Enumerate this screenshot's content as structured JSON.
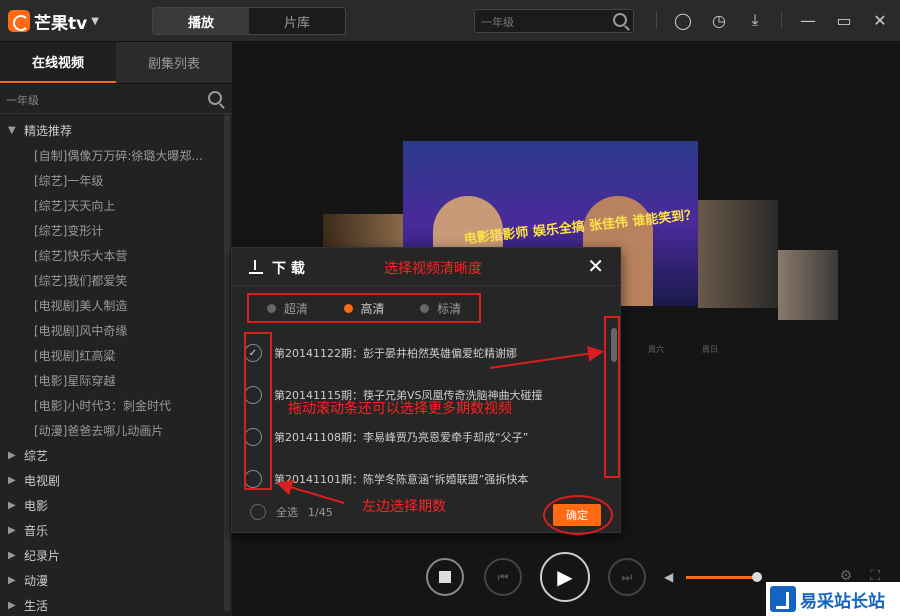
{
  "app": {
    "logo_text": "芒果tv",
    "tabs": [
      "播放",
      "片库"
    ],
    "search_placeholder": "一年级"
  },
  "sidebar": {
    "tabs": [
      "在线视频",
      "剧集列表"
    ],
    "search_placeholder": "一年级",
    "featured": {
      "label": "精选推荐",
      "items": [
        "[自制]偶像万万碎:徐璐大曝郑...",
        "[综艺]一年级",
        "[综艺]天天向上",
        "[综艺]变形计",
        "[综艺]快乐大本营",
        "[综艺]我们都爱笑",
        "[电视剧]美人制造",
        "[电视剧]风中奇缘",
        "[电视剧]红高粱",
        "[电影]星际穿越",
        "[电影]小时代3：刺金时代",
        "[动漫]爸爸去哪儿动画片"
      ]
    },
    "categories": [
      "综艺",
      "电视剧",
      "电影",
      "音乐",
      "纪录片",
      "动漫",
      "生活"
    ]
  },
  "poster": {
    "caption": "电影猎影师 娱乐全搞 张佳伟 谁能笑到？"
  },
  "timeline": {
    "labels": [
      "周六",
      "周日"
    ]
  },
  "dialog": {
    "title": "下 载",
    "close": "✕",
    "quality": [
      {
        "label": "超清",
        "selected": false
      },
      {
        "label": "高清",
        "selected": true
      },
      {
        "label": "标清",
        "selected": false
      }
    ],
    "episodes": [
      {
        "label": "第20141122期：彭于晏井柏然英雄偏爱蛇精谢娜",
        "checked": true
      },
      {
        "label": "第20141115期：筷子兄弟VS凤凰传奇洗脑神曲大碰撞",
        "checked": false
      },
      {
        "label": "第20141108期：李易峰贾乃亮恩爱牵手却成“父子”",
        "checked": false
      },
      {
        "label": "第20141101期：陈学冬陈意涵“拆婚联盟”强拆快本",
        "checked": false
      }
    ],
    "select_all": "全选",
    "count": "1/45",
    "confirm": "确定"
  },
  "annotations": {
    "quality": "选择视频清晰度",
    "scroll": "拖动滚动条还可以选择更多期数视频",
    "left": "左边选择期数"
  },
  "watermark": {
    "text": "易采站长站"
  },
  "colors": {
    "accent": "#ff6a13",
    "annotation": "#d81e1e"
  }
}
